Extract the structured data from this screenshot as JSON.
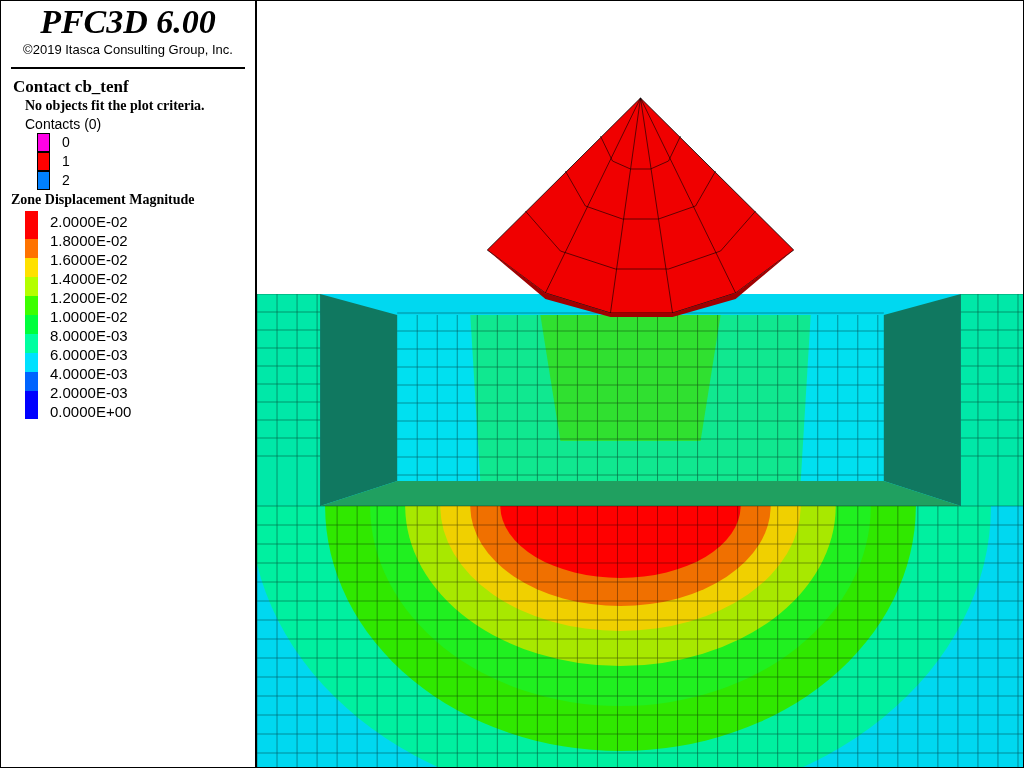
{
  "legend": {
    "title": "PFC3D 6.00",
    "copyright": "©2019 Itasca Consulting Group, Inc.",
    "contact_plot": {
      "title": "Contact cb_tenf",
      "message": "No objects fit the plot criteria.",
      "subtitle": "Contacts (0)",
      "items": [
        {
          "label": "0",
          "color": "#ff00e6"
        },
        {
          "label": "1",
          "color": "#ff0000"
        },
        {
          "label": "2",
          "color": "#0080ff"
        }
      ]
    },
    "zone_plot": {
      "title": "Zone Displacement Magnitude",
      "labels": [
        "2.0000E-02",
        "1.8000E-02",
        "1.6000E-02",
        "1.4000E-02",
        "1.2000E-02",
        "1.0000E-02",
        "8.0000E-03",
        "6.0000E-03",
        "4.0000E-03",
        "2.0000E-03",
        "0.0000E+00"
      ],
      "bands": [
        {
          "color": "#ff0000"
        },
        {
          "color": "#ff7300"
        },
        {
          "color": "#ffe100"
        },
        {
          "color": "#b4ff00"
        },
        {
          "color": "#3cff00"
        },
        {
          "color": "#00ff3c"
        },
        {
          "color": "#00ffa0"
        },
        {
          "color": "#00e1ff"
        },
        {
          "color": "#0064ff"
        },
        {
          "color": "#0000ff"
        }
      ]
    }
  }
}
